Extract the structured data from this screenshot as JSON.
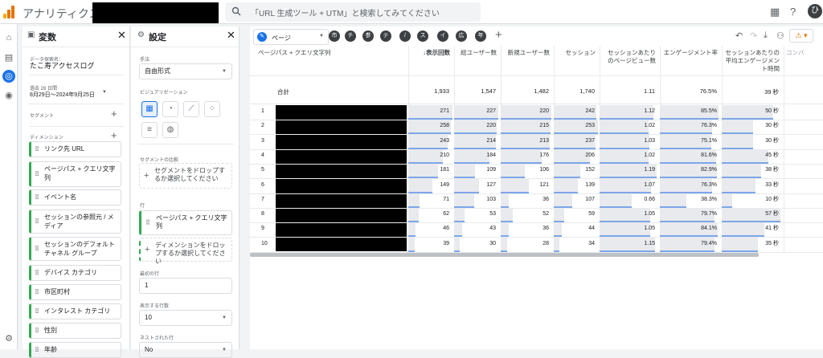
{
  "topbar": {
    "app_title": "アナリティクス",
    "search_placeholder": "「URL 生成ツール + UTM」と検索してみてください",
    "avatar_initial": "ひ"
  },
  "variables": {
    "title": "変数",
    "exploration_label": "データ探索名：",
    "exploration_name": "たこ寿アクセスログ",
    "date_label": "過去 28 日間",
    "date_range": "8月29日～2024年9月25日",
    "segments_label": "セグメント",
    "dimensions_label": "ディメンション",
    "dimensions": [
      "リンク先 URL",
      "ページパス + クエリ文字列",
      "イベント名",
      "セッションの参照元 / メディア",
      "セッションのデフォルト チャネル グループ",
      "デバイス カテゴリ",
      "市区町村",
      "インタレスト カテゴリ",
      "性別",
      "年齢"
    ]
  },
  "settings": {
    "title": "設定",
    "technique_label": "手法",
    "technique_value": "自由形式",
    "viz_label": "ビジュアリゼーション",
    "segment_compare_label": "セグメントの比較",
    "segment_drop": "セグメントをドロップするか選択してください",
    "rows_label": "行",
    "row_dimension": "ページパス + クエリ文字列",
    "dim_drop": "ディメンションをドロップするか選択してください",
    "first_row_label": "最初の行",
    "first_row_value": "1",
    "rows_shown_label": "表示する行数",
    "rows_shown_value": "10",
    "nested_label": "ネストされた行",
    "nested_value": "No"
  },
  "tab": {
    "name": "ページ",
    "chips": [
      "市",
      "チ",
      "参",
      "テ",
      "/",
      "ス",
      "イ",
      "広",
      "年"
    ]
  },
  "table": {
    "dim_header": "ページパス + クエリ文字列",
    "headers": [
      "↓表示回数",
      "総ユーザー数",
      "新規ユーザー数",
      "セッション",
      "セッションあたりのページビュー数",
      "エンゲージメント率",
      "セッションあたりの平均エンゲージメント時間",
      "コンバ"
    ],
    "total_label": "合計",
    "totals": [
      "1,933",
      "1,547",
      "1,482",
      "1,740",
      "1.11",
      "76.5%",
      "39 秒"
    ],
    "rows": [
      {
        "n": "1",
        "v": [
          "271",
          "227",
          "220",
          "242",
          "1.12",
          "85.5%",
          "50 秒"
        ]
      },
      {
        "n": "2",
        "v": [
          "258",
          "220",
          "215",
          "253",
          "1.02",
          "76.3%",
          "30 秒"
        ]
      },
      {
        "n": "3",
        "v": [
          "243",
          "214",
          "213",
          "237",
          "1.03",
          "75.1%",
          "30 秒"
        ]
      },
      {
        "n": "4",
        "v": [
          "210",
          "184",
          "176",
          "206",
          "1.02",
          "81.6%",
          "45 秒"
        ]
      },
      {
        "n": "5",
        "v": [
          "181",
          "109",
          "106",
          "152",
          "1.19",
          "82.9%",
          "38 秒"
        ]
      },
      {
        "n": "6",
        "v": [
          "149",
          "127",
          "121",
          "139",
          "1.07",
          "76.3%",
          "33 秒"
        ]
      },
      {
        "n": "7",
        "v": [
          "71",
          "103",
          "36",
          "107",
          "0.66",
          "38.3%",
          "10 秒"
        ]
      },
      {
        "n": "8",
        "v": [
          "62",
          "53",
          "52",
          "59",
          "1.05",
          "79.7%",
          "57 秒"
        ]
      },
      {
        "n": "9",
        "v": [
          "46",
          "43",
          "36",
          "44",
          "1.05",
          "84.1%",
          "41 秒"
        ]
      },
      {
        "n": "10",
        "v": [
          "39",
          "30",
          "28",
          "34",
          "1.15",
          "79.4%",
          "35 秒"
        ]
      }
    ]
  }
}
